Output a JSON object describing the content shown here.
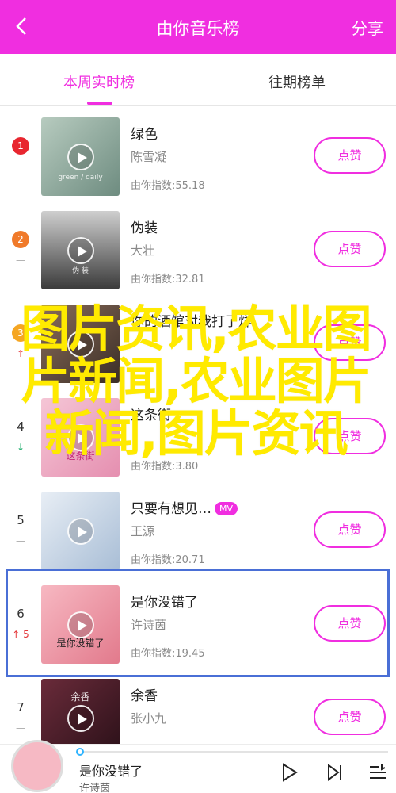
{
  "header": {
    "title": "由你音乐榜",
    "share_label": "分享"
  },
  "tabs": [
    {
      "label": "本周实时榜"
    },
    {
      "label": "往期榜单"
    }
  ],
  "like_label": "点赞",
  "watermark": "图片资讯,农业图片新闻,农业图片新闻,图片资讯",
  "colors": {
    "accent": "#f02ee0",
    "highlight": "#4a6fd6",
    "watermark": "#ffea00"
  },
  "songs": [
    {
      "rank": "1",
      "trend": "—",
      "title": "绿色",
      "artist": "陈雪凝",
      "index": "由你指数:55.18",
      "cover_text": "green / daily"
    },
    {
      "rank": "2",
      "trend": "—",
      "title": "伪装",
      "artist": "大壮",
      "index": "由你指数:32.81",
      "cover_text": "伪 装"
    },
    {
      "rank": "3",
      "trend": "↑",
      "title": "你的酒馆对我打了烊",
      "artist": "",
      "index": "",
      "cover_text": ""
    },
    {
      "rank": "4",
      "trend": "↓",
      "title": "这条街",
      "artist": "",
      "index": "由你指数:3.80",
      "cover_text": "这条街"
    },
    {
      "rank": "5",
      "trend": "—",
      "title": "只要有想见…",
      "artist": "王源",
      "index": "由你指数:20.71",
      "cover_text": "",
      "mv": "MV"
    },
    {
      "rank": "6",
      "trend": "↑ 5",
      "title": "是你没错了",
      "artist": "许诗茵",
      "index": "由你指数:19.45",
      "cover_text": "是你没错了"
    },
    {
      "rank": "7",
      "trend": "—",
      "title": "余香",
      "artist": "张小九",
      "index": "",
      "cover_text": "余香"
    }
  ],
  "player": {
    "title": "是你没错了",
    "artist": "许诗茵"
  }
}
